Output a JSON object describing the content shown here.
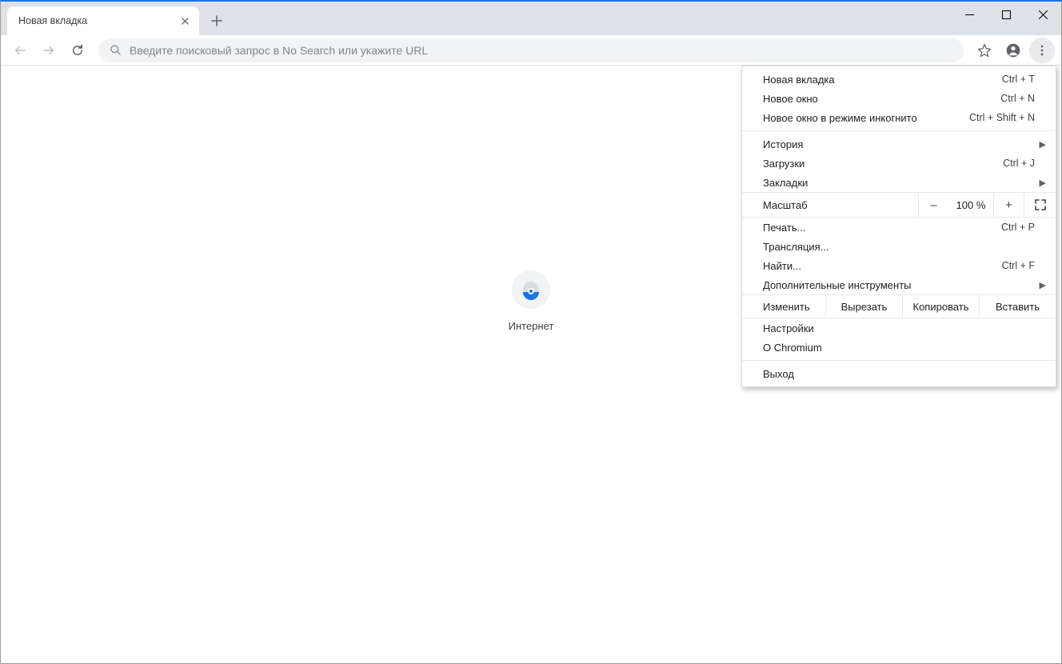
{
  "tab": {
    "title": "Новая вкладка"
  },
  "omnibox": {
    "placeholder": "Введите поисковый запрос в No Search или укажите URL"
  },
  "shortcut": {
    "label": "Интернет"
  },
  "menu": {
    "new_tab": {
      "label": "Новая вкладка",
      "shortcut": "Ctrl + T"
    },
    "new_window": {
      "label": "Новое окно",
      "shortcut": "Ctrl + N"
    },
    "incognito": {
      "label": "Новое окно в режиме инкогнито",
      "shortcut": "Ctrl + Shift + N"
    },
    "history": {
      "label": "История"
    },
    "downloads": {
      "label": "Загрузки",
      "shortcut": "Ctrl + J"
    },
    "bookmarks": {
      "label": "Закладки"
    },
    "zoom": {
      "label": "Масштаб",
      "value": "100 %"
    },
    "print": {
      "label": "Печать...",
      "shortcut": "Ctrl + P"
    },
    "cast": {
      "label": "Трансляция..."
    },
    "find": {
      "label": "Найти...",
      "shortcut": "Ctrl + F"
    },
    "more_tools": {
      "label": "Дополнительные инструменты"
    },
    "edit": {
      "label": "Изменить",
      "cut": "Вырезать",
      "copy": "Копировать",
      "paste": "Вставить"
    },
    "settings": {
      "label": "Настройки"
    },
    "about": {
      "label": "О Chromium"
    },
    "exit": {
      "label": "Выход"
    }
  }
}
